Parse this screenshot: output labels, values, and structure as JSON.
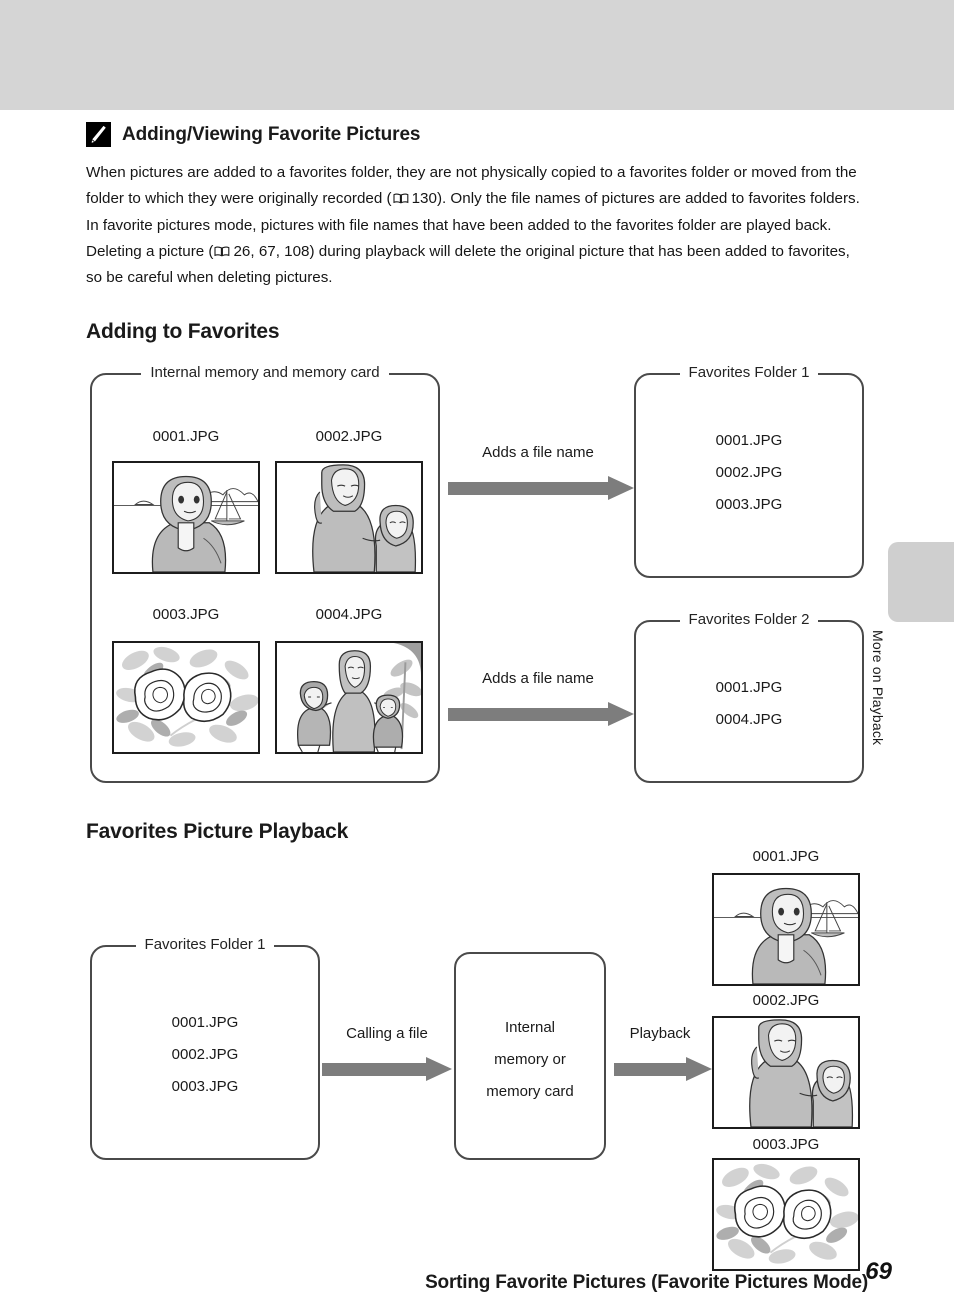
{
  "header": {
    "title": "Sorting Favorite Pictures (Favorite Pictures Mode)"
  },
  "side_tab": {
    "label": "More on Playback"
  },
  "note": {
    "icon": "pencil-icon",
    "title": "Adding/Viewing Favorite Pictures",
    "body_part1": "When pictures are added to a favorites folder, they are not physically copied to a favorites folder or moved from the folder to which they were originally recorded (",
    "ref1": "130",
    "body_part2": "). Only the file names of pictures are added to favorites folders. In favorite pictures mode, pictures with file names that have been added to the favorites folder are played back. Deleting a picture (",
    "ref2": "26, 67, 108",
    "body_part3": ") during playback will delete the original picture that has been added to favorites, so be careful when deleting pictures."
  },
  "sections": {
    "adding": {
      "heading": "Adding to Favorites",
      "source_box": {
        "legend": "Internal memory and memory card",
        "thumbs": [
          {
            "caption": "0001.JPG",
            "art": "woman-sailboat"
          },
          {
            "caption": "0002.JPG",
            "art": "mother-daughter"
          },
          {
            "caption": "0003.JPG",
            "art": "flowers"
          },
          {
            "caption": "0004.JPG",
            "art": "family-tree"
          }
        ]
      },
      "arrows": [
        {
          "label": "Adds a file name"
        },
        {
          "label": "Adds a file name"
        }
      ],
      "folders": [
        {
          "legend": "Favorites Folder 1",
          "files": [
            "0001.JPG",
            "0002.JPG",
            "0003.JPG"
          ]
        },
        {
          "legend": "Favorites Folder 2",
          "files": [
            "0001.JPG",
            "0004.JPG"
          ]
        }
      ]
    },
    "playback": {
      "heading": "Favorites Picture Playback",
      "folder": {
        "legend": "Favorites Folder 1",
        "files": [
          "0001.JPG",
          "0002.JPG",
          "0003.JPG"
        ]
      },
      "arrow1_label": "Calling a file",
      "memory_box": {
        "lines": [
          "Internal",
          "memory or",
          "memory card"
        ]
      },
      "arrow2_label": "Playback",
      "thumbs": [
        {
          "caption": "0001.JPG",
          "art": "woman-sailboat"
        },
        {
          "caption": "0002.JPG",
          "art": "mother-daughter"
        },
        {
          "caption": "0003.JPG",
          "art": "flowers"
        }
      ]
    }
  },
  "page_number": "69"
}
